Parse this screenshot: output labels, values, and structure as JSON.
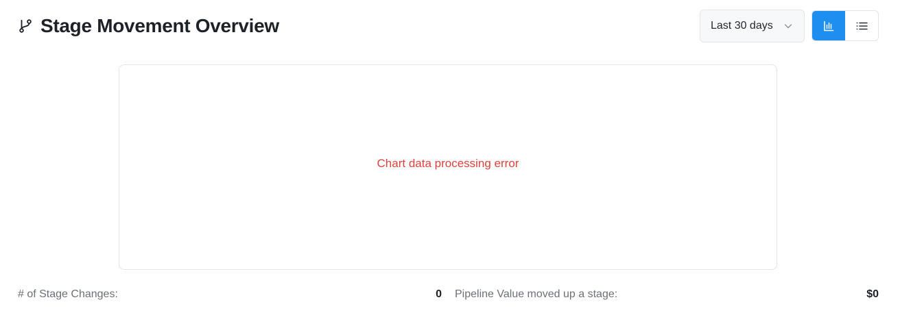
{
  "header": {
    "title": "Stage Movement Overview",
    "title_icon": "git-branch-icon"
  },
  "controls": {
    "date_range": {
      "selected": "Last 30 days",
      "icon": "chevron-down-icon"
    },
    "view_toggle": {
      "active": "chart",
      "chart_icon": "bar-chart-icon",
      "list_icon": "list-icon",
      "accent_color": "#1f8ef1"
    }
  },
  "chart": {
    "error_message": "Chart data processing error",
    "error_color": "#e0403a"
  },
  "stats": {
    "stage_changes_label": "# of Stage Changes:",
    "stage_changes_value": "0",
    "pipeline_label": "Pipeline Value moved up a stage:",
    "pipeline_value": "$0"
  }
}
